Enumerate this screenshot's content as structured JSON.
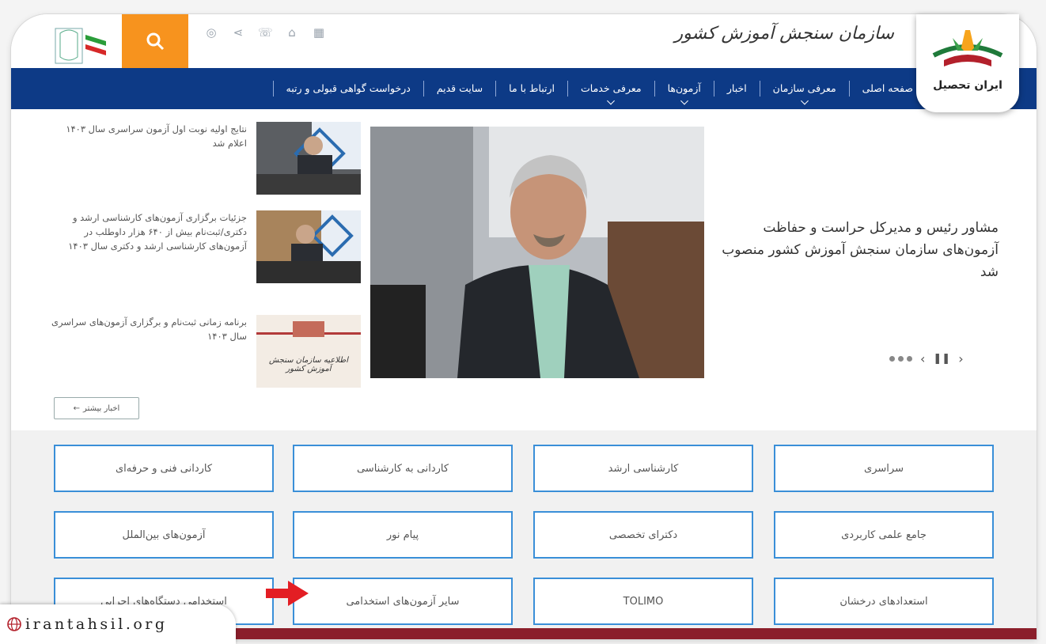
{
  "header": {
    "site_title": "سازمان سنجش آموزش کشور",
    "icons": [
      "globe-icon",
      "share-icon",
      "phone-icon",
      "home-icon",
      "sitemap-icon"
    ]
  },
  "nav": {
    "items": [
      {
        "label": "صفحه اصلی",
        "caret": false
      },
      {
        "label": "معرفی سازمان",
        "caret": true
      },
      {
        "label": "اخبار",
        "caret": false
      },
      {
        "label": "آزمون‌ها",
        "caret": true
      },
      {
        "label": "معرفی خدمات",
        "caret": true
      },
      {
        "label": "ارتباط با ما",
        "caret": false
      },
      {
        "label": "سایت قدیم",
        "caret": false
      },
      {
        "label": "درخواست گواهی قبولی و رتبه",
        "caret": false
      }
    ]
  },
  "brand": {
    "label": "ایران تحصیل"
  },
  "hero": {
    "headline": "مشاور رئیس و مدیرکل حراست و حفاظت آزمون‌های سازمان سنجش آموزش کشور منصوب شد"
  },
  "news": [
    {
      "text": "نتایج اولیه نوبت اول آزمون سراسری سال ۱۴۰۳ اعلام شد"
    },
    {
      "text": "جزئیات برگزاری آزمون‌های کارشناسی ارشد و دکتری/ثبت‌نام بیش از ۶۴۰ هزار داوطلب در آزمون‌های کارشناسی ارشد و دکتری سال ۱۴۰۳"
    },
    {
      "text": "برنامه زمانی ثبت‌نام و برگزاری آزمون‌های سراسری سال ۱۴۰۳",
      "thumb_caption": "اطلاعیه سازمان سنجش آموزش کشور"
    }
  ],
  "more_news": "اخبار بیشتر",
  "tiles": [
    {
      "label": "سراسری"
    },
    {
      "label": "کارشناسی ارشد"
    },
    {
      "label": "کاردانی به کارشناسی"
    },
    {
      "label": "کاردانی فنی و حرفه‌ای"
    },
    {
      "label": "جامع علمی کاربردی"
    },
    {
      "label": "دکترای تخصصی"
    },
    {
      "label": "پیام نور"
    },
    {
      "label": "آزمون‌های بین‌الملل"
    },
    {
      "label": "استعدادهای درخشان"
    },
    {
      "label": "TOLIMO"
    },
    {
      "label": "سایر آزمون‌های استخدامی"
    },
    {
      "label": "استخدامی دستگاه‌های اجرایی"
    }
  ],
  "watermark": {
    "text": "irantahsil.org"
  },
  "colors": {
    "nav_bg": "#0d3a86",
    "search_bg": "#f7931e",
    "tile_border": "#3a8fd8",
    "strip": "#8b1f2b"
  }
}
